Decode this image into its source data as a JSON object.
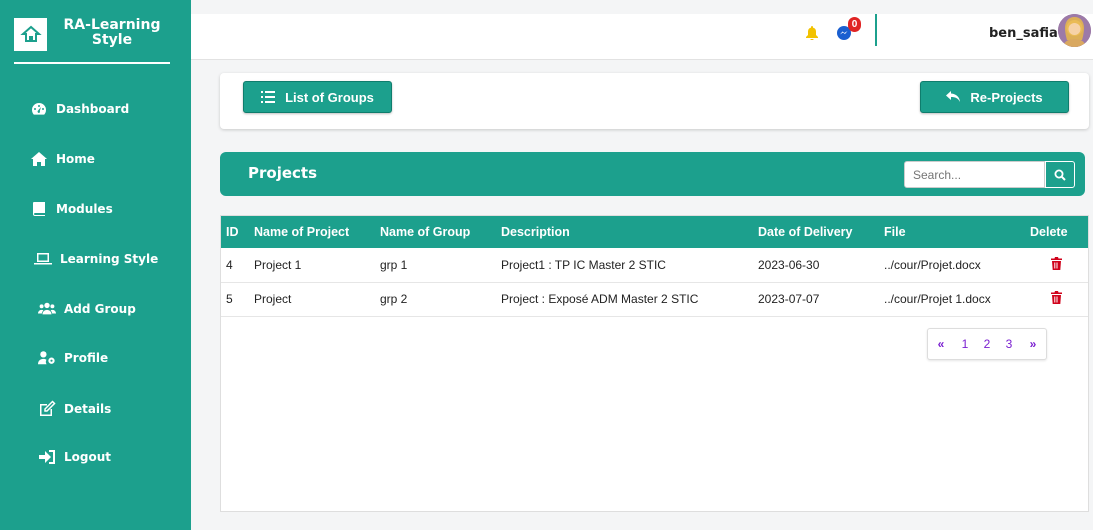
{
  "brand": {
    "name": "RA-Learning Style",
    "logo_icon": "home-laptop-icon"
  },
  "sidebar": {
    "items": [
      {
        "label": "Dashboard",
        "icon": "dashboard-icon"
      },
      {
        "label": "Home",
        "icon": "home-icon"
      },
      {
        "label": "Modules",
        "icon": "book-icon"
      },
      {
        "label": "Learning Style",
        "icon": "laptop-icon"
      },
      {
        "label": "Add Group",
        "icon": "users-icon"
      },
      {
        "label": "Profile",
        "icon": "user-cog-icon"
      },
      {
        "label": "Details",
        "icon": "edit-icon"
      },
      {
        "label": "Logout",
        "icon": "sign-out-icon"
      }
    ]
  },
  "topbar": {
    "notification_count": "0",
    "username": "ben_safia"
  },
  "toolbar": {
    "list_groups_label": "List of Groups",
    "reprojects_label": "Re-Projects"
  },
  "projects": {
    "title": "Projects",
    "search_placeholder": "Search..."
  },
  "table": {
    "headers": [
      "ID",
      "Name of Project",
      "Name of Group",
      "Description",
      "Date of Delivery",
      "File",
      "Delete"
    ],
    "rows": [
      {
        "id": "4",
        "name": "Project 1",
        "group": "grp 1",
        "description": "Project1 : TP IC Master 2 STIC",
        "date": "2023-06-30",
        "file": "../cour/Projet.docx"
      },
      {
        "id": "5",
        "name": "Project",
        "group": "grp 2",
        "description": "Project : Exposé ADM Master 2 STIC",
        "date": "2023-07-07",
        "file": "../cour/Projet 1.docx"
      }
    ]
  },
  "pagination": {
    "prev": "«",
    "pages": [
      "1",
      "2",
      "3"
    ],
    "next": "»"
  },
  "colors": {
    "accent": "#1ca08d",
    "delete": "#d0021b",
    "badge": "#e02424",
    "pager_text": "#7a1fd0"
  }
}
